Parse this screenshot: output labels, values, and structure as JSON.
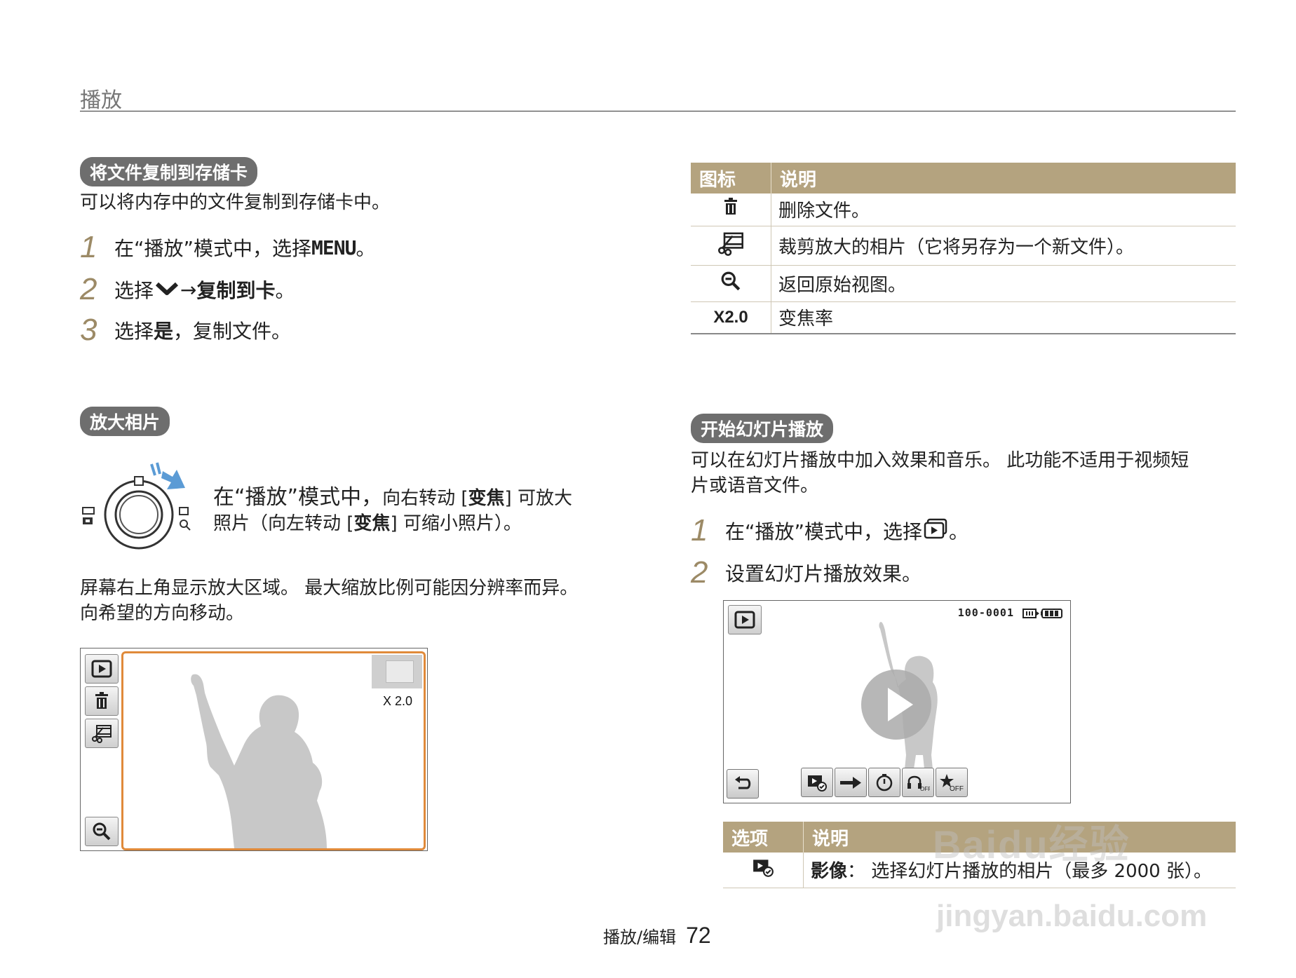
{
  "header": {
    "section_title": "播放"
  },
  "copy_section": {
    "heading": "将文件复制到存储卡",
    "intro": "可以将内存中的文件复制到存储卡中。",
    "steps": [
      {
        "num": "1",
        "pre": "在“播放”模式中，选择 ",
        "bold": "MENU",
        "post": "。"
      },
      {
        "num": "2",
        "pre": "选择 ",
        "arrow": " → ",
        "bold": "复制到卡",
        "post": "。"
      },
      {
        "num": "3",
        "pre": "选择",
        "bold": "是",
        "post": "，复制文件。"
      }
    ]
  },
  "zoom_section": {
    "heading": "放大相片",
    "desc_large": "在“播放”模式中，",
    "desc_part1": "向右转动 [",
    "zoom_key": "变焦",
    "desc_part2": "] 可放大",
    "desc_line2_a": "照片（向左转动 [",
    "desc_line2_b": "] 可缩小照片）。",
    "para1": "屏幕右上角显示放大区域。 最大缩放比例可能因分辨率而异。",
    "para2": "向希望的方向移动。",
    "zoom_readout": "X 2.0"
  },
  "icon_table": {
    "headers": [
      "图标",
      "说明"
    ],
    "rows": [
      {
        "icon": "trash-icon",
        "text": "删除文件。"
      },
      {
        "icon": "trim-icon",
        "text": "裁剪放大的相片（它将另存为一个新文件）。"
      },
      {
        "icon": "zoom-out-icon",
        "text": "返回原始视图。"
      },
      {
        "label": "X2.0",
        "text": "变焦率"
      }
    ]
  },
  "slideshow_section": {
    "heading": "开始幻灯片播放",
    "intro_line1": "可以在幻灯片播放中加入效果和音乐。 此功能不适用于视频短",
    "intro_line2": "片或语音文件。",
    "steps": [
      {
        "num": "1",
        "pre": "在“播放”模式中，选择 ",
        "post": "。"
      },
      {
        "num": "2",
        "text": "设置幻灯片播放效果。"
      }
    ],
    "file_number": "100-0001",
    "toolbar_icons": [
      "back-icon",
      "image-select-icon",
      "effect-arrow-icon",
      "interval-timer-icon",
      "music-off-icon",
      "effect-off-icon"
    ]
  },
  "option_table": {
    "headers": [
      "选项",
      "说明"
    ],
    "rows": [
      {
        "icon": "image-select-icon",
        "label": "影像",
        "text": "： 选择幻灯片播放的相片（最多 2000 张）。"
      }
    ]
  },
  "footer": {
    "chapter": "播放/编辑",
    "page": "72"
  },
  "watermark": {
    "line1": "Baidu经验",
    "line2": "jingyan.baidu.com"
  }
}
